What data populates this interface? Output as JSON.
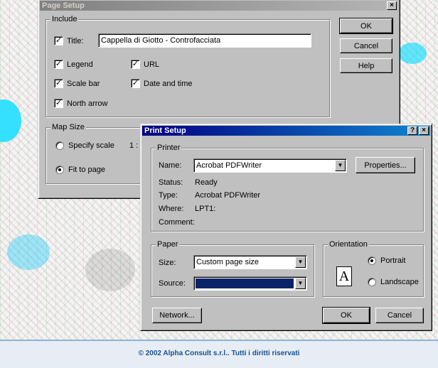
{
  "page_setup": {
    "title": "Page Setup",
    "close_glyph": "×",
    "include_group": "Include",
    "title_check_label": "Title:",
    "title_value": "Cappella di Giotto - Controfacciata",
    "legend_label": "Legend",
    "url_label": "URL",
    "scale_bar_label": "Scale bar",
    "date_time_label": "Date and time",
    "north_arrow_label": "North arrow",
    "map_size_group": "Map Size",
    "specify_scale_label": "Specify scale",
    "scale_prefix": "1 :",
    "fit_to_page_label": "Fit to page",
    "ok_label": "OK",
    "cancel_label": "Cancel",
    "help_label": "Help",
    "check_glyph": "✓"
  },
  "print_setup": {
    "title": "Print Setup",
    "help_glyph": "?",
    "close_glyph": "×",
    "printer_group": "Printer",
    "name_label": "Name:",
    "name_value": "Acrobat PDFWriter",
    "properties_label": "Properties...",
    "status_label": "Status:",
    "status_value": "Ready",
    "type_label": "Type:",
    "type_value": "Acrobat PDFWriter",
    "where_label": "Where:",
    "where_value": "LPT1:",
    "comment_label": "Comment:",
    "comment_value": "",
    "paper_group": "Paper",
    "size_label": "Size:",
    "size_value": "Custom page size",
    "source_label": "Source:",
    "source_value": "",
    "orientation_group": "Orientation",
    "orientation_icon_letter": "A",
    "portrait_label": "Portrait",
    "landscape_label": "Landscape",
    "network_label": "Network...",
    "ok_label": "OK",
    "cancel_label": "Cancel",
    "arrow_glyph": "▼"
  },
  "footer": {
    "copyright": "© 2002 Alpha Consult s.r.l.. Tutti i diritti riservati"
  },
  "colors": {
    "title_active": "#000080",
    "dialog_face": "#c0c0c0",
    "source_selected": "#0a246a",
    "footer_text": "#1a4f8f"
  }
}
